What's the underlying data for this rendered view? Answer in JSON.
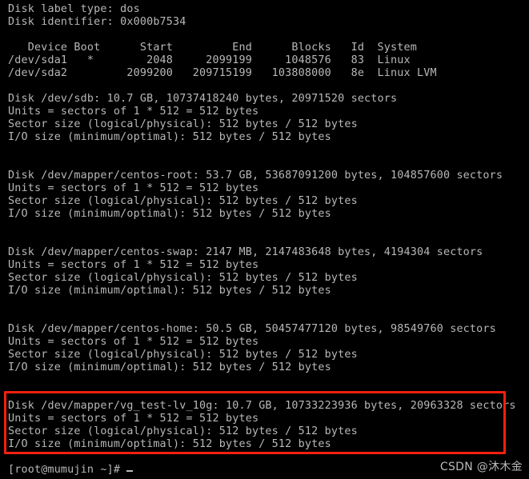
{
  "terminal": {
    "colors": {
      "background": "#000000",
      "foreground": "#b8b8b8",
      "highlight_border": "#f3200f",
      "watermark": "#c9c9c9"
    },
    "lines": [
      "Disk label type: dos",
      "Disk identifier: 0x000b7534",
      "",
      "   Device Boot      Start         End      Blocks   Id  System",
      "/dev/sda1   *        2048     2099199     1048576   83  Linux",
      "/dev/sda2         2099200   209715199   103808000   8e  Linux LVM",
      "",
      "Disk /dev/sdb: 10.7 GB, 10737418240 bytes, 20971520 sectors",
      "Units = sectors of 1 * 512 = 512 bytes",
      "Sector size (logical/physical): 512 bytes / 512 bytes",
      "I/O size (minimum/optimal): 512 bytes / 512 bytes",
      "",
      "",
      "Disk /dev/mapper/centos-root: 53.7 GB, 53687091200 bytes, 104857600 sectors",
      "Units = sectors of 1 * 512 = 512 bytes",
      "Sector size (logical/physical): 512 bytes / 512 bytes",
      "I/O size (minimum/optimal): 512 bytes / 512 bytes",
      "",
      "",
      "Disk /dev/mapper/centos-swap: 2147 MB, 2147483648 bytes, 4194304 sectors",
      "Units = sectors of 1 * 512 = 512 bytes",
      "Sector size (logical/physical): 512 bytes / 512 bytes",
      "I/O size (minimum/optimal): 512 bytes / 512 bytes",
      "",
      "",
      "Disk /dev/mapper/centos-home: 50.5 GB, 50457477120 bytes, 98549760 sectors",
      "Units = sectors of 1 * 512 = 512 bytes",
      "Sector size (logical/physical): 512 bytes / 512 bytes",
      "I/O size (minimum/optimal): 512 bytes / 512 bytes",
      "",
      "",
      "Disk /dev/mapper/vg_test-lv_10g: 10.7 GB, 10733223936 bytes, 20963328 sectors",
      "Units = sectors of 1 * 512 = 512 bytes",
      "Sector size (logical/physical): 512 bytes / 512 bytes",
      "I/O size (minimum/optimal): 512 bytes / 512 bytes",
      ""
    ],
    "prompt": "[root@mumujin ~]#",
    "disk_label": {
      "type_line": "Disk label type: dos",
      "identifier_line": "Disk identifier: 0x000b7534",
      "type_value": "dos",
      "identifier_value": "0x000b7534"
    },
    "partition_table": {
      "headers": [
        "Device",
        "Boot",
        "Start",
        "End",
        "Blocks",
        "Id",
        "System"
      ],
      "rows": [
        {
          "device": "/dev/sda1",
          "boot": "*",
          "start": "2048",
          "end": "2099199",
          "blocks": "1048576",
          "id": "83",
          "system": "Linux"
        },
        {
          "device": "/dev/sda2",
          "boot": "",
          "start": "2099200",
          "end": "209715199",
          "blocks": "103808000",
          "id": "8e",
          "system": "Linux LVM"
        }
      ]
    },
    "disks": [
      {
        "name": "/dev/sdb",
        "size_human": "10.7 GB",
        "size_bytes": "10737418240 bytes",
        "sectors": "20971520 sectors",
        "units": "Units = sectors of 1 * 512 = 512 bytes",
        "sector_size": "Sector size (logical/physical): 512 bytes / 512 bytes",
        "io_size": "I/O size (minimum/optimal): 512 bytes / 512 bytes",
        "highlighted": false
      },
      {
        "name": "/dev/mapper/centos-root",
        "size_human": "53.7 GB",
        "size_bytes": "53687091200 bytes",
        "sectors": "104857600 sectors",
        "units": "Units = sectors of 1 * 512 = 512 bytes",
        "sector_size": "Sector size (logical/physical): 512 bytes / 512 bytes",
        "io_size": "I/O size (minimum/optimal): 512 bytes / 512 bytes",
        "highlighted": false
      },
      {
        "name": "/dev/mapper/centos-swap",
        "size_human": "2147 MB",
        "size_bytes": "2147483648 bytes",
        "sectors": "4194304 sectors",
        "units": "Units = sectors of 1 * 512 = 512 bytes",
        "sector_size": "Sector size (logical/physical): 512 bytes / 512 bytes",
        "io_size": "I/O size (minimum/optimal): 512 bytes / 512 bytes",
        "highlighted": false
      },
      {
        "name": "/dev/mapper/centos-home",
        "size_human": "50.5 GB",
        "size_bytes": "50457477120 bytes",
        "sectors": "98549760 sectors",
        "units": "Units = sectors of 1 * 512 = 512 bytes",
        "sector_size": "Sector size (logical/physical): 512 bytes / 512 bytes",
        "io_size": "I/O size (minimum/optimal): 512 bytes / 512 bytes",
        "highlighted": false
      },
      {
        "name": "/dev/mapper/vg_test-lv_10g",
        "size_human": "10.7 GB",
        "size_bytes": "10733223936 bytes",
        "sectors": "20963328 sectors",
        "units": "Units = sectors of 1 * 512 = 512 bytes",
        "sector_size": "Sector size (logical/physical): 512 bytes / 512 bytes",
        "io_size": "I/O size (minimum/optimal): 512 bytes / 512 bytes",
        "highlighted": true
      }
    ]
  },
  "watermark": {
    "text": "CSDN @沐木金"
  }
}
